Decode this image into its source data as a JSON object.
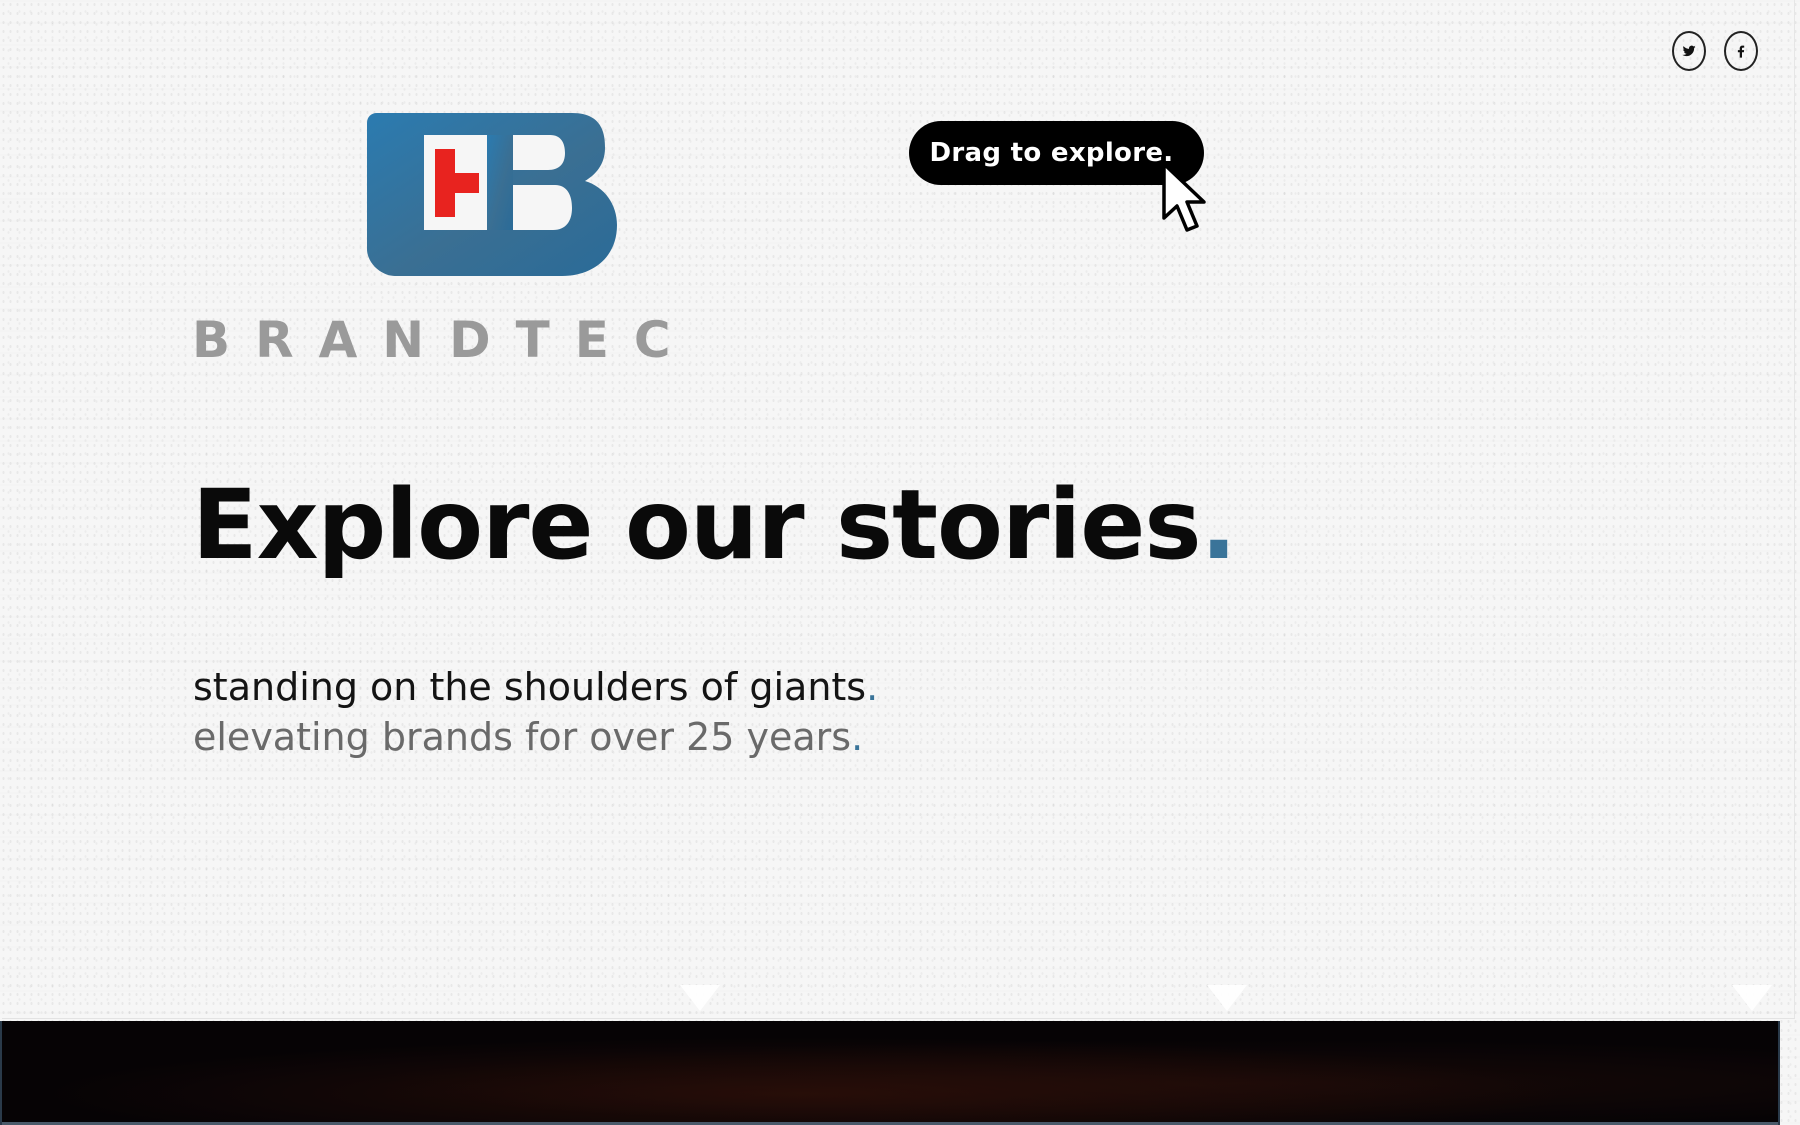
{
  "social": {
    "twitter_label": "Twitter",
    "facebook_label": "Facebook"
  },
  "brand": {
    "wordmark": "BRANDTEC",
    "mark_colors": {
      "blue": "#2f74a0",
      "red": "#e8231f"
    }
  },
  "drag_hint": {
    "label": "Drag to explore."
  },
  "hero": {
    "headline": "Explore our stories",
    "headline_dot": ".",
    "tagline_line1": "standing on the shoulders of giants",
    "tagline_line2": "elevating brands for over 25 years",
    "tagline_dot": "."
  },
  "colors": {
    "background": "#f6f6f6",
    "accent": "#3a7499",
    "text": "#0a0a0a",
    "muted": "#6a6a6a"
  }
}
